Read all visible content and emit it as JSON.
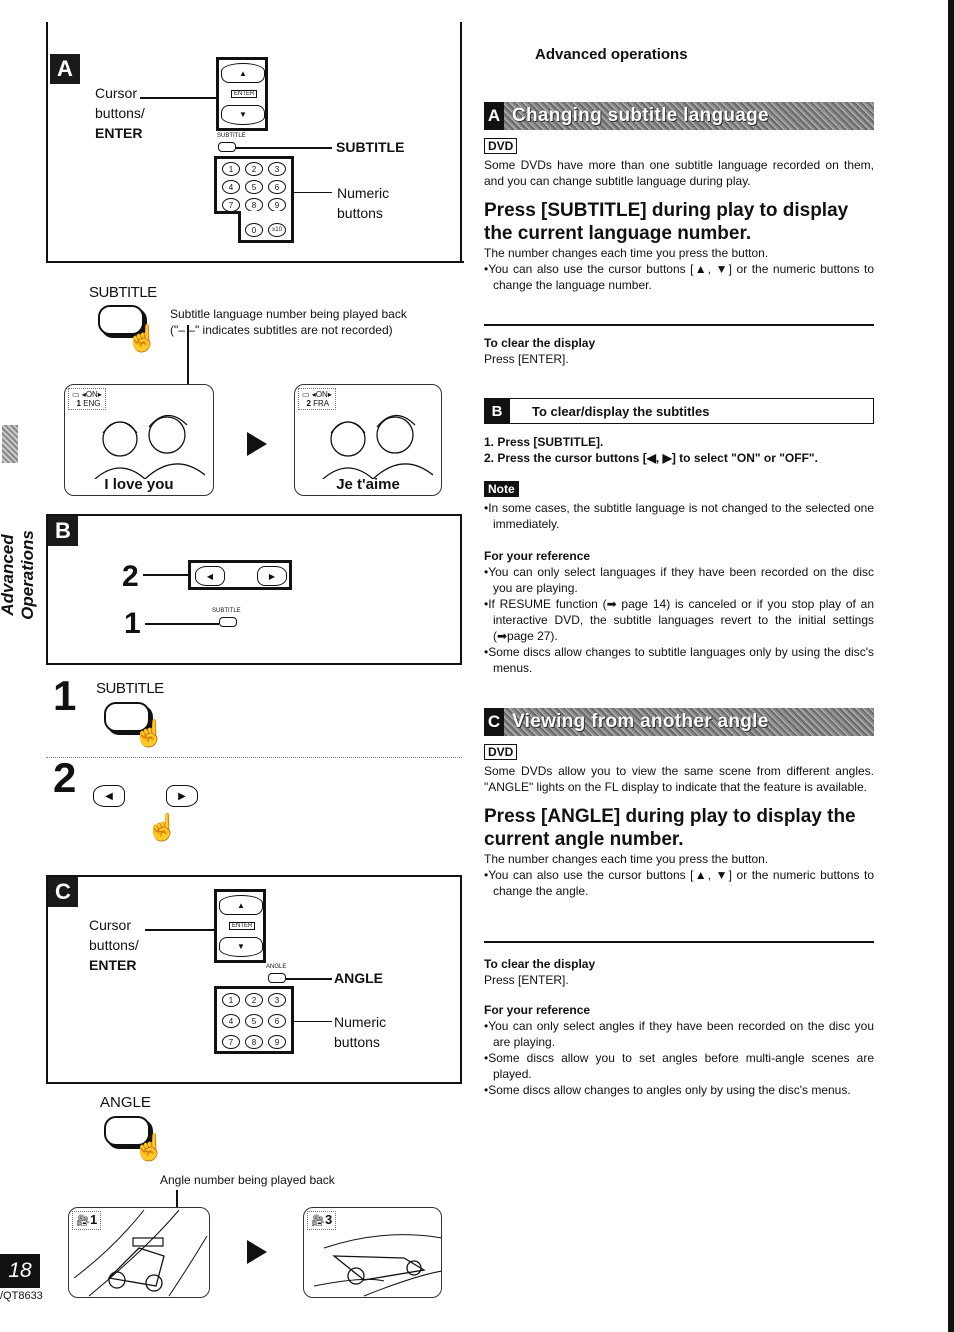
{
  "page": {
    "section_label": "Advanced Operations",
    "page_number": "18",
    "doc_code": "/QT8633",
    "header": "Advanced operations"
  },
  "left": {
    "panel_a": {
      "letter": "A",
      "cursor_label_1": "Cursor",
      "cursor_label_2": "buttons/",
      "cursor_label_3": "ENTER",
      "enter_key": "ENTER",
      "up_symbol": "▲",
      "down_symbol": "▼",
      "button_small_label": "SUBTITLE",
      "button_label": "SUBTITLE",
      "numeric_label_1": "Numeric",
      "numeric_label_2": "buttons",
      "numbers": [
        "1",
        "2",
        "3",
        "4",
        "5",
        "6",
        "7",
        "8",
        "9",
        "0",
        "≥10"
      ]
    },
    "subtitle_demo": {
      "button_label": "SUBTITLE",
      "desc_1": "Subtitle language number being played back",
      "desc_2": "(\"– –\" indicates subtitles are not recorded)",
      "screen1": {
        "osd_state": "◂ON▸",
        "osd_num": "1",
        "osd_lang": "ENG",
        "caption": "I love you"
      },
      "screen2": {
        "osd_state": "◂ON▸",
        "osd_num": "2",
        "osd_lang": "FRA",
        "caption": "Je t'aime"
      }
    },
    "panel_b": {
      "letter": "B",
      "step2": "2",
      "step1": "1",
      "left_symbol": "◀",
      "right_symbol": "▶",
      "button_small_label": "SUBTITLE"
    },
    "steps": {
      "step1_num": "1",
      "step1_label": "SUBTITLE",
      "step2_num": "2",
      "left_symbol": "◀",
      "right_symbol": "▶"
    },
    "panel_c": {
      "letter": "C",
      "cursor_label_1": "Cursor",
      "cursor_label_2": "buttons/",
      "cursor_label_3": "ENTER",
      "enter_key": "ENTER",
      "up_symbol": "▲",
      "down_symbol": "▼",
      "button_small_label": "ANGLE",
      "button_label": "ANGLE",
      "numeric_label_1": "Numeric",
      "numeric_label_2": "buttons",
      "numbers": [
        "1",
        "2",
        "3",
        "4",
        "5",
        "6",
        "7",
        "8",
        "9"
      ]
    },
    "angle_demo": {
      "button_label": "ANGLE",
      "desc": "Angle number being played back",
      "screen1": {
        "angle_num": "1"
      },
      "screen2": {
        "angle_num": "3"
      }
    }
  },
  "right": {
    "section_a": {
      "letter": "A",
      "title": "Changing subtitle language",
      "tag": "DVD",
      "intro": "Some DVDs have more than one subtitle language recorded on them, and you can change subtitle language during play.",
      "heading": "Press [SUBTITLE] during play to display the current language number.",
      "line1": "The number changes each time you press the button.",
      "bullet1": "•You can also use the cursor buttons [▲, ▼] or the numeric buttons to change the language number.",
      "clear_head": "To clear the display",
      "clear_text": "Press [ENTER]."
    },
    "section_b": {
      "letter": "B",
      "title": "To clear/display the subtitles",
      "steps": [
        "1.  Press [SUBTITLE].",
        "2.  Press the cursor buttons [◀, ▶] to select \"ON\" or \"OFF\"."
      ],
      "note_label": "Note",
      "note": "•In some cases, the subtitle language is not changed to the selected one immediately.",
      "ref_head": "For your reference",
      "refs": [
        "•You can only select languages if they have been recorded on the disc you are playing.",
        "•If RESUME function (➡ page 14) is canceled or if you stop play of an interactive DVD, the subtitle languages revert to the initial settings (➡page 27).",
        "•Some discs allow changes to subtitle languages only by using the disc's menus."
      ]
    },
    "section_c": {
      "letter": "C",
      "title": "Viewing from another angle",
      "tag": "DVD",
      "intro": "Some DVDs allow you to view the same scene from different angles. \"ANGLE\" lights on the FL display to indicate that the feature is available.",
      "heading": "Press [ANGLE] during play to display the current angle number.",
      "line1": "The number changes each time you press the button.",
      "bullet1": "•You can also use the cursor buttons [▲, ▼] or the numeric buttons to change the angle.",
      "clear_head": "To clear the display",
      "clear_text": "Press [ENTER].",
      "ref_head": "For your reference",
      "refs": [
        "•You can only select angles if they have been recorded on the disc you are playing.",
        "•Some discs allow you to set angles before multi-angle scenes are played.",
        "•Some discs allow changes to angles only by using the disc's menus."
      ]
    }
  }
}
